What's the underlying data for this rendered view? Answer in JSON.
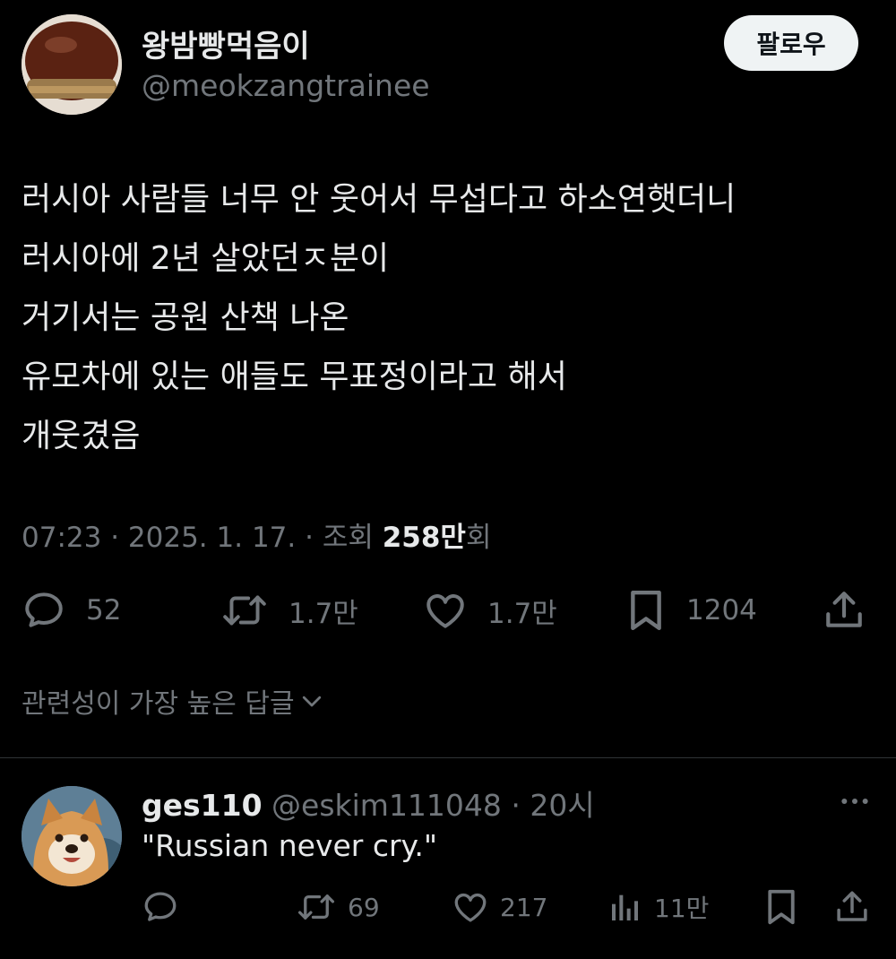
{
  "tweet": {
    "author": {
      "display_name": "왕밤빵먹음이",
      "handle": "@meokzangtrainee"
    },
    "follow_label": "팔로우",
    "lines": [
      "러시아 사람들 너무 안 웃어서 무섭다고 하소연햇더니",
      "러시아에 2년 살았던ㅈ분이",
      "거기서는 공원 산책 나온",
      "유모차에 있는 애들도 무표정이라고 해서",
      "개웃겼음"
    ],
    "meta": {
      "time": "07:23",
      "sep1": " · ",
      "date": "2025. 1. 17.",
      "sep2": " · ",
      "views_label": "조회 ",
      "views_value": "258만",
      "views_unit": "회"
    },
    "actions": {
      "replies": "52",
      "retweets": "1.7만",
      "likes": "1.7만",
      "bookmarks": "1204"
    },
    "related_label": "관련성이 가장 높은 답글"
  },
  "reply": {
    "display_name": "ges110",
    "handle": " @eskim111048 · 20시",
    "text": "\"Russian never cry.\"",
    "actions": {
      "retweets": "69",
      "likes": "217",
      "views": "11만"
    }
  },
  "icons": {
    "reply": "speech-bubble-icon",
    "retweet": "retweet-icon",
    "like": "heart-icon",
    "bookmark": "bookmark-icon",
    "share": "share-upload-icon",
    "views": "bar-chart-icon",
    "more": "more-dots-icon",
    "chevron": "chevron-down-icon"
  },
  "colors": {
    "background": "#000000",
    "text": "#e7e9ea",
    "muted": "#71767b",
    "follow_bg": "#eff3f4"
  }
}
